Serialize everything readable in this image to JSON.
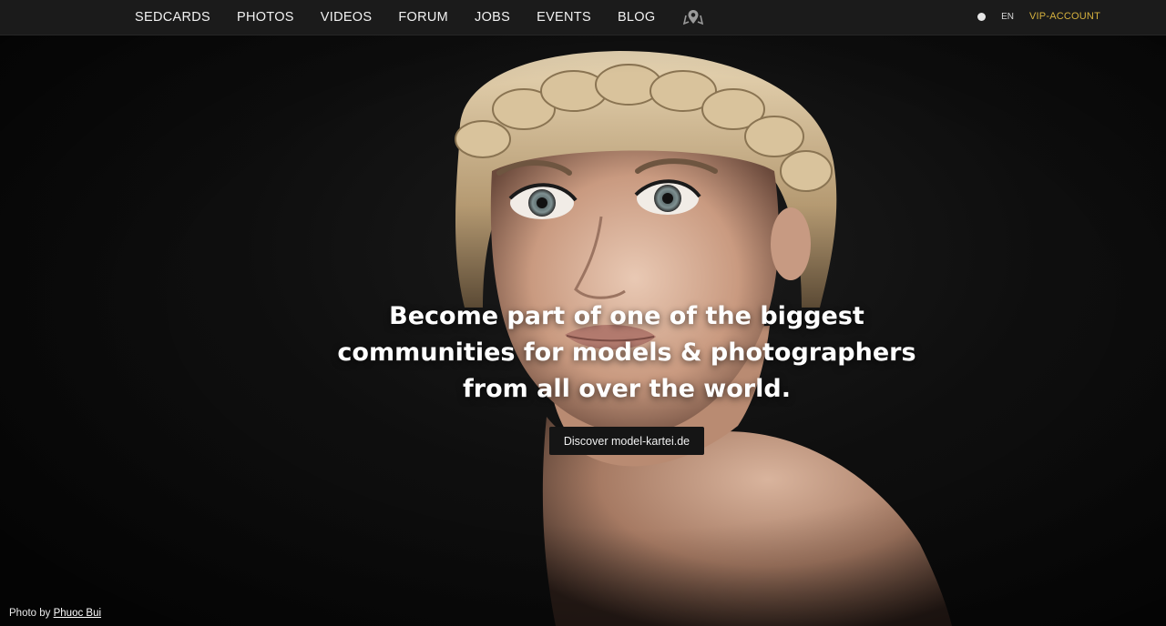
{
  "nav": {
    "items": [
      {
        "label": "SEDCARDS"
      },
      {
        "label": "PHOTOS"
      },
      {
        "label": "VIDEOS"
      },
      {
        "label": "FORUM"
      },
      {
        "label": "JOBS"
      },
      {
        "label": "EVENTS"
      },
      {
        "label": "BLOG"
      }
    ],
    "map_icon": "map-pin-icon"
  },
  "right_nav": {
    "status_icon": "status-dot-icon",
    "language": "EN",
    "vip_label": "VIP-ACCOUNT"
  },
  "hero": {
    "headline": "Become part of one of the biggest communities for models & photographers from all over the world.",
    "cta_label": "Discover model-kartei.de"
  },
  "credit": {
    "prefix": "Photo by",
    "author": "Phuoc Bui"
  },
  "colors": {
    "topbar_bg": "#1b1b1b",
    "vip_accent": "#d6b13e",
    "cta_bg": "#151515"
  }
}
